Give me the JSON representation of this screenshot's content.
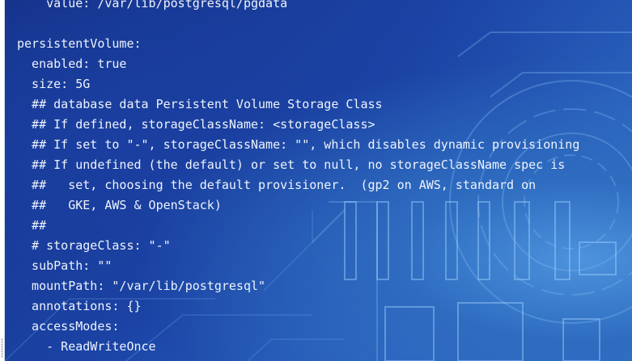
{
  "terminal": {
    "lines": [
      "    value: /var/lib/postgresql/pgdata",
      "",
      "persistentVolume:",
      "  enabled: true",
      "  size: 5G",
      "  ## database data Persistent Volume Storage Class",
      "  ## If defined, storageClassName: <storageClass>",
      "  ## If set to \"-\", storageClassName: \"\", which disables dynamic provisioning",
      "  ## If undefined (the default) or set to null, no storageClassName spec is",
      "  ##   set, choosing the default provisioner.  (gp2 on AWS, standard on",
      "  ##   GKE, AWS & OpenStack)",
      "  ##",
      "  # storageClass: \"-\"",
      "  subPath: \"\"",
      "  mountPath: \"/var/lib/postgresql\"",
      "  annotations: {}",
      "  accessModes:",
      "    - ReadWriteOnce",
      "    # ..."
    ]
  },
  "colors": {
    "text": "#eef3fb",
    "background_dark": "#142f86",
    "background_light": "#2f73c8"
  }
}
